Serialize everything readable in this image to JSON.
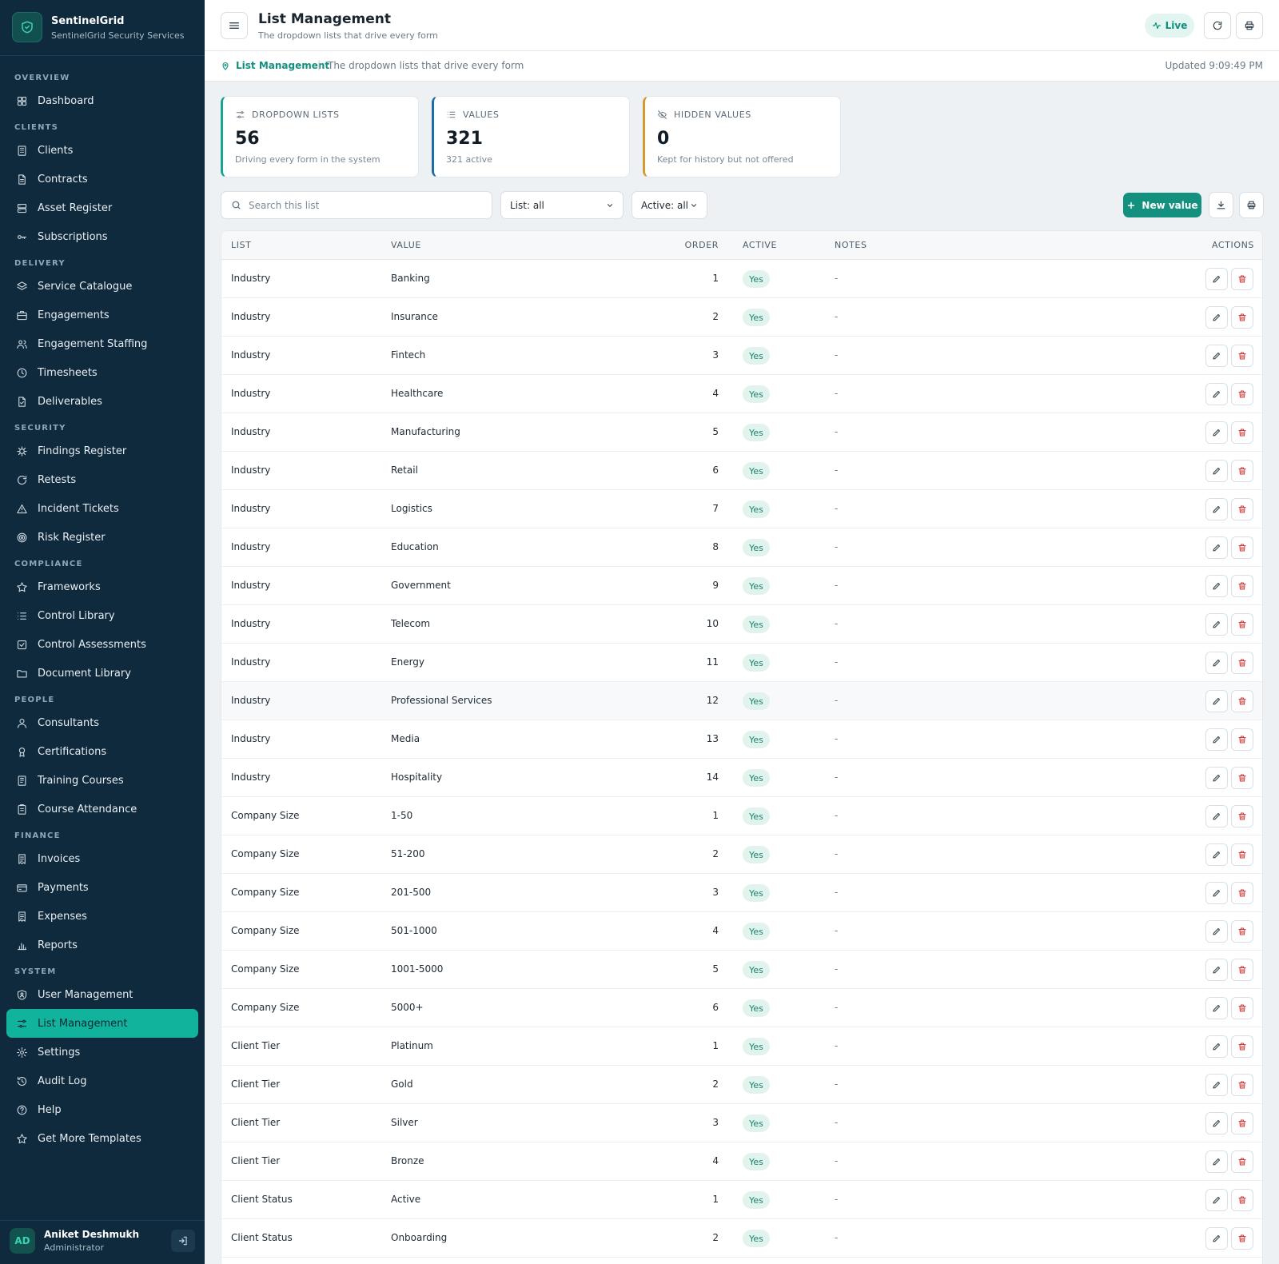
{
  "brand": {
    "name": "SentinelGrid",
    "subtitle": "SentinelGrid Security Services"
  },
  "nav": [
    {
      "section": "OVERVIEW",
      "items": [
        {
          "label": "Dashboard",
          "icon": "grid-icon"
        }
      ]
    },
    {
      "section": "CLIENTS",
      "items": [
        {
          "label": "Clients",
          "icon": "building-icon"
        },
        {
          "label": "Contracts",
          "icon": "file-icon"
        },
        {
          "label": "Asset Register",
          "icon": "server-icon"
        },
        {
          "label": "Subscriptions",
          "icon": "key-icon"
        }
      ]
    },
    {
      "section": "DELIVERY",
      "items": [
        {
          "label": "Service Catalogue",
          "icon": "layers-icon"
        },
        {
          "label": "Engagements",
          "icon": "briefcase-icon"
        },
        {
          "label": "Engagement Staffing",
          "icon": "users-icon"
        },
        {
          "label": "Timesheets",
          "icon": "clock-icon"
        },
        {
          "label": "Deliverables",
          "icon": "file-check-icon"
        }
      ]
    },
    {
      "section": "SECURITY",
      "items": [
        {
          "label": "Findings Register",
          "icon": "bug-icon"
        },
        {
          "label": "Retests",
          "icon": "refresh-icon"
        },
        {
          "label": "Incident Tickets",
          "icon": "alert-triangle-icon"
        },
        {
          "label": "Risk Register",
          "icon": "target-icon"
        }
      ]
    },
    {
      "section": "COMPLIANCE",
      "items": [
        {
          "label": "Frameworks",
          "icon": "star-icon"
        },
        {
          "label": "Control Library",
          "icon": "list-icon"
        },
        {
          "label": "Control Assessments",
          "icon": "check-square-icon"
        },
        {
          "label": "Document Library",
          "icon": "folder-icon"
        }
      ]
    },
    {
      "section": "PEOPLE",
      "items": [
        {
          "label": "Consultants",
          "icon": "user-icon"
        },
        {
          "label": "Certifications",
          "icon": "award-icon"
        },
        {
          "label": "Training Courses",
          "icon": "book-icon"
        },
        {
          "label": "Course Attendance",
          "icon": "clipboard-icon"
        }
      ]
    },
    {
      "section": "FINANCE",
      "items": [
        {
          "label": "Invoices",
          "icon": "receipt-icon"
        },
        {
          "label": "Payments",
          "icon": "credit-card-icon"
        },
        {
          "label": "Expenses",
          "icon": "receipt-icon"
        },
        {
          "label": "Reports",
          "icon": "bar-chart-icon"
        }
      ]
    },
    {
      "section": "SYSTEM",
      "items": [
        {
          "label": "User Management",
          "icon": "user-shield-icon"
        },
        {
          "label": "List Management",
          "icon": "sliders-icon",
          "active": true
        },
        {
          "label": "Settings",
          "icon": "gear-icon"
        },
        {
          "label": "Audit Log",
          "icon": "history-icon"
        },
        {
          "label": "Help",
          "icon": "help-circle-icon"
        },
        {
          "label": "Get More Templates",
          "icon": "star-icon"
        }
      ]
    }
  ],
  "user": {
    "initials": "AD",
    "name": "Aniket Deshmukh",
    "role": "Administrator"
  },
  "header": {
    "title": "List Management",
    "subtitle": "The dropdown lists that drive every form",
    "live_label": "Live"
  },
  "breadcrumb": {
    "current": "List Management",
    "description": "The dropdown lists that drive every form",
    "updated": "Updated 9:09:49 PM"
  },
  "stats": [
    {
      "label": "DROPDOWN LISTS",
      "value": "56",
      "note": "Driving every form in the system",
      "accent": "#13a58f",
      "icon": "sliders-icon"
    },
    {
      "label": "VALUES",
      "value": "321",
      "note": "321 active",
      "accent": "#1f6ea3",
      "icon": "list-icon"
    },
    {
      "label": "HIDDEN VALUES",
      "value": "0",
      "note": "Kept for history but not offered",
      "accent": "#d39a2c",
      "icon": "eye-off-icon"
    }
  ],
  "toolbar": {
    "search_placeholder": "Search this list",
    "list_filter": "List: all",
    "active_filter": "Active: all",
    "new_label": "New value"
  },
  "table": {
    "columns": {
      "list": "LIST",
      "value": "VALUE",
      "order": "ORDER",
      "active": "ACTIVE",
      "notes": "NOTES",
      "actions": "ACTIONS"
    },
    "rows": [
      {
        "list": "Industry",
        "value": "Banking",
        "order": "1",
        "active": "Yes",
        "notes": "-"
      },
      {
        "list": "Industry",
        "value": "Insurance",
        "order": "2",
        "active": "Yes",
        "notes": "-"
      },
      {
        "list": "Industry",
        "value": "Fintech",
        "order": "3",
        "active": "Yes",
        "notes": "-"
      },
      {
        "list": "Industry",
        "value": "Healthcare",
        "order": "4",
        "active": "Yes",
        "notes": "-"
      },
      {
        "list": "Industry",
        "value": "Manufacturing",
        "order": "5",
        "active": "Yes",
        "notes": "-"
      },
      {
        "list": "Industry",
        "value": "Retail",
        "order": "6",
        "active": "Yes",
        "notes": "-"
      },
      {
        "list": "Industry",
        "value": "Logistics",
        "order": "7",
        "active": "Yes",
        "notes": "-"
      },
      {
        "list": "Industry",
        "value": "Education",
        "order": "8",
        "active": "Yes",
        "notes": "-"
      },
      {
        "list": "Industry",
        "value": "Government",
        "order": "9",
        "active": "Yes",
        "notes": "-"
      },
      {
        "list": "Industry",
        "value": "Telecom",
        "order": "10",
        "active": "Yes",
        "notes": "-"
      },
      {
        "list": "Industry",
        "value": "Energy",
        "order": "11",
        "active": "Yes",
        "notes": "-"
      },
      {
        "list": "Industry",
        "value": "Professional Services",
        "order": "12",
        "active": "Yes",
        "notes": "-",
        "highlight": true
      },
      {
        "list": "Industry",
        "value": "Media",
        "order": "13",
        "active": "Yes",
        "notes": "-"
      },
      {
        "list": "Industry",
        "value": "Hospitality",
        "order": "14",
        "active": "Yes",
        "notes": "-"
      },
      {
        "list": "Company Size",
        "value": "1-50",
        "order": "1",
        "active": "Yes",
        "notes": "-"
      },
      {
        "list": "Company Size",
        "value": "51-200",
        "order": "2",
        "active": "Yes",
        "notes": "-"
      },
      {
        "list": "Company Size",
        "value": "201-500",
        "order": "3",
        "active": "Yes",
        "notes": "-"
      },
      {
        "list": "Company Size",
        "value": "501-1000",
        "order": "4",
        "active": "Yes",
        "notes": "-"
      },
      {
        "list": "Company Size",
        "value": "1001-5000",
        "order": "5",
        "active": "Yes",
        "notes": "-"
      },
      {
        "list": "Company Size",
        "value": "5000+",
        "order": "6",
        "active": "Yes",
        "notes": "-"
      },
      {
        "list": "Client Tier",
        "value": "Platinum",
        "order": "1",
        "active": "Yes",
        "notes": "-"
      },
      {
        "list": "Client Tier",
        "value": "Gold",
        "order": "2",
        "active": "Yes",
        "notes": "-"
      },
      {
        "list": "Client Tier",
        "value": "Silver",
        "order": "3",
        "active": "Yes",
        "notes": "-"
      },
      {
        "list": "Client Tier",
        "value": "Bronze",
        "order": "4",
        "active": "Yes",
        "notes": "-"
      },
      {
        "list": "Client Status",
        "value": "Active",
        "order": "1",
        "active": "Yes",
        "notes": "-"
      },
      {
        "list": "Client Status",
        "value": "Onboarding",
        "order": "2",
        "active": "Yes",
        "notes": "-"
      }
    ]
  }
}
